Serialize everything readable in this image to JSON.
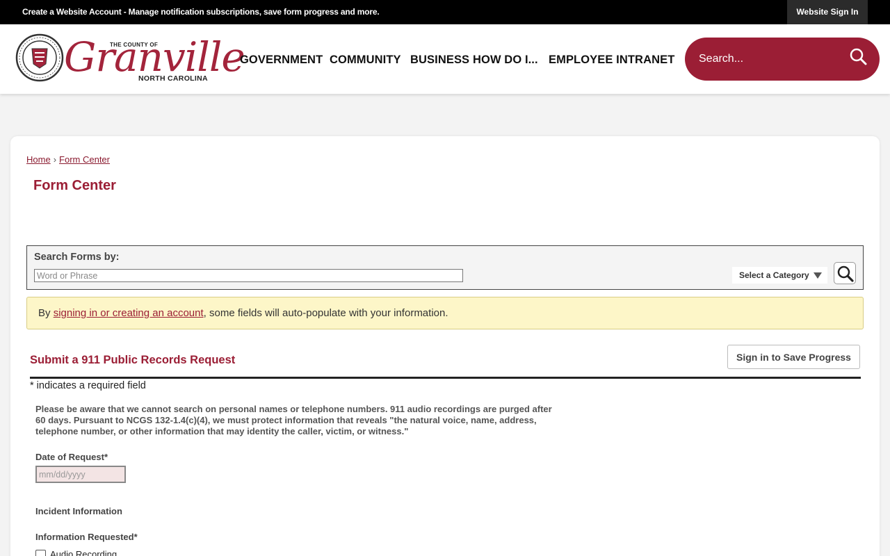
{
  "topbar": {
    "create_account_link": "Create a Website Account",
    "message": " - Manage notification subscriptions, save form progress and more.",
    "sign_in": "Website Sign In"
  },
  "header": {
    "logo_top": "THE COUNTY OF",
    "logo_main": "Granville",
    "logo_bottom": "NORTH CAROLINA",
    "nav": [
      "GOVERNMENT",
      "COMMUNITY",
      "BUSINESS",
      "HOW DO I...",
      "EMPLOYEE INTRANET"
    ],
    "search_placeholder": "Search..."
  },
  "breadcrumb": {
    "home": "Home",
    "separator": "›",
    "current": "Form Center"
  },
  "page_title": "Form Center",
  "search_forms": {
    "label": "Search Forms by:",
    "placeholder": "Word or Phrase",
    "category_select": "Select a Category"
  },
  "notice": {
    "prefix": "By ",
    "link": "signing in or creating an account",
    "suffix": ", some fields will auto-populate with your information."
  },
  "form": {
    "title": "Submit a 911 Public Records Request",
    "save_button": "Sign in to Save Progress",
    "required_note": "* indicates a required field",
    "description": "Please be aware that we cannot search on personal names or telephone numbers. 911 audio recordings are purged after 60 days. Pursuant to NCGS 132-1.4(c)(4), we must protect information that reveals \"the natural voice, name, address, telephone number, or other information that may identity the caller, victim, or witness.\"",
    "date_label": "Date of Request*",
    "date_placeholder": "mm/dd/yyyy",
    "incident_heading": "Incident Information",
    "info_requested_label": "Information Requested*",
    "options": [
      "Audio Recording"
    ]
  },
  "colors": {
    "brand": "#9b1e35",
    "topbar": "#000000",
    "notice_bg": "#fdf6c8"
  }
}
